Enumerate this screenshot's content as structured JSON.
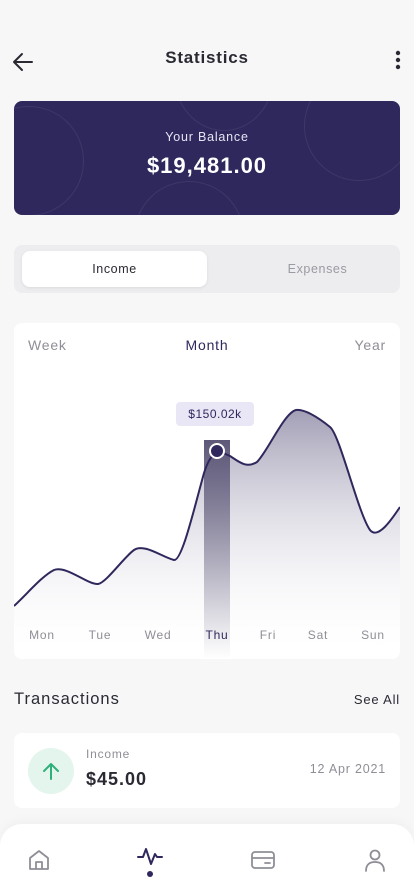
{
  "header": {
    "title": "Statistics"
  },
  "balance": {
    "label": "Your Balance",
    "amount": "$19,481.00"
  },
  "toggle": {
    "options": [
      "Income",
      "Expenses"
    ],
    "selected": "Income"
  },
  "chart": {
    "periods": [
      "Week",
      "Month",
      "Year"
    ],
    "selected_period": "Month",
    "tooltip": "$150.02k",
    "selected_day": "Thu"
  },
  "chart_data": {
    "type": "area",
    "categories": [
      "Mon",
      "Tue",
      "Wed",
      "Thu",
      "Fri",
      "Sat",
      "Sun"
    ],
    "highlighted": "Thu",
    "highlighted_value_label": "$150.02k"
  },
  "transactions": {
    "title": "Transactions",
    "see_all": "See All",
    "items": [
      {
        "category": "Income",
        "amount": "$45.00",
        "date": "12 Apr 2021",
        "icon": "arrow-up-icon"
      }
    ]
  },
  "tabbar": {
    "items": [
      "home-icon",
      "activity-icon",
      "wallet-icon",
      "profile-icon"
    ],
    "active": "activity-icon"
  },
  "colors": {
    "primary": "#2e285c",
    "background": "#f7f7f8",
    "income_green": "#2fb07a"
  }
}
